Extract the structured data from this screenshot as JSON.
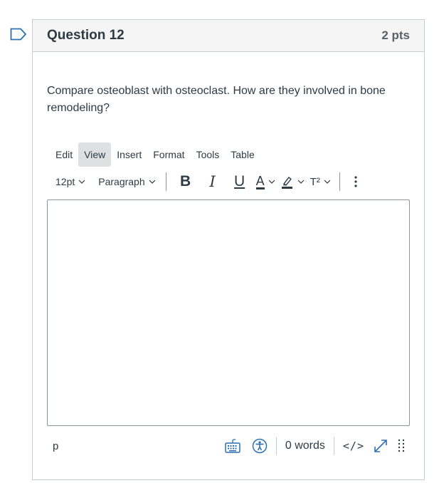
{
  "question": {
    "title": "Question 12",
    "points": "2 pts",
    "text": "Compare osteoblast with osteoclast. How are they involved in bone remodeling?"
  },
  "menubar": {
    "items": [
      "Edit",
      "View",
      "Insert",
      "Format",
      "Tools",
      "Table"
    ]
  },
  "toolbar": {
    "font_size": "12pt",
    "block_format": "Paragraph",
    "bold": "B",
    "italic": "I",
    "underline": "U",
    "text_color": "A",
    "superscript": "T²"
  },
  "statusbar": {
    "path": "p",
    "word_count": "0 words",
    "html_editor": "</>"
  },
  "colors": {
    "accent_blue": "#2d6fb3",
    "text": "#2d3b45",
    "border": "#c7cdd1"
  }
}
